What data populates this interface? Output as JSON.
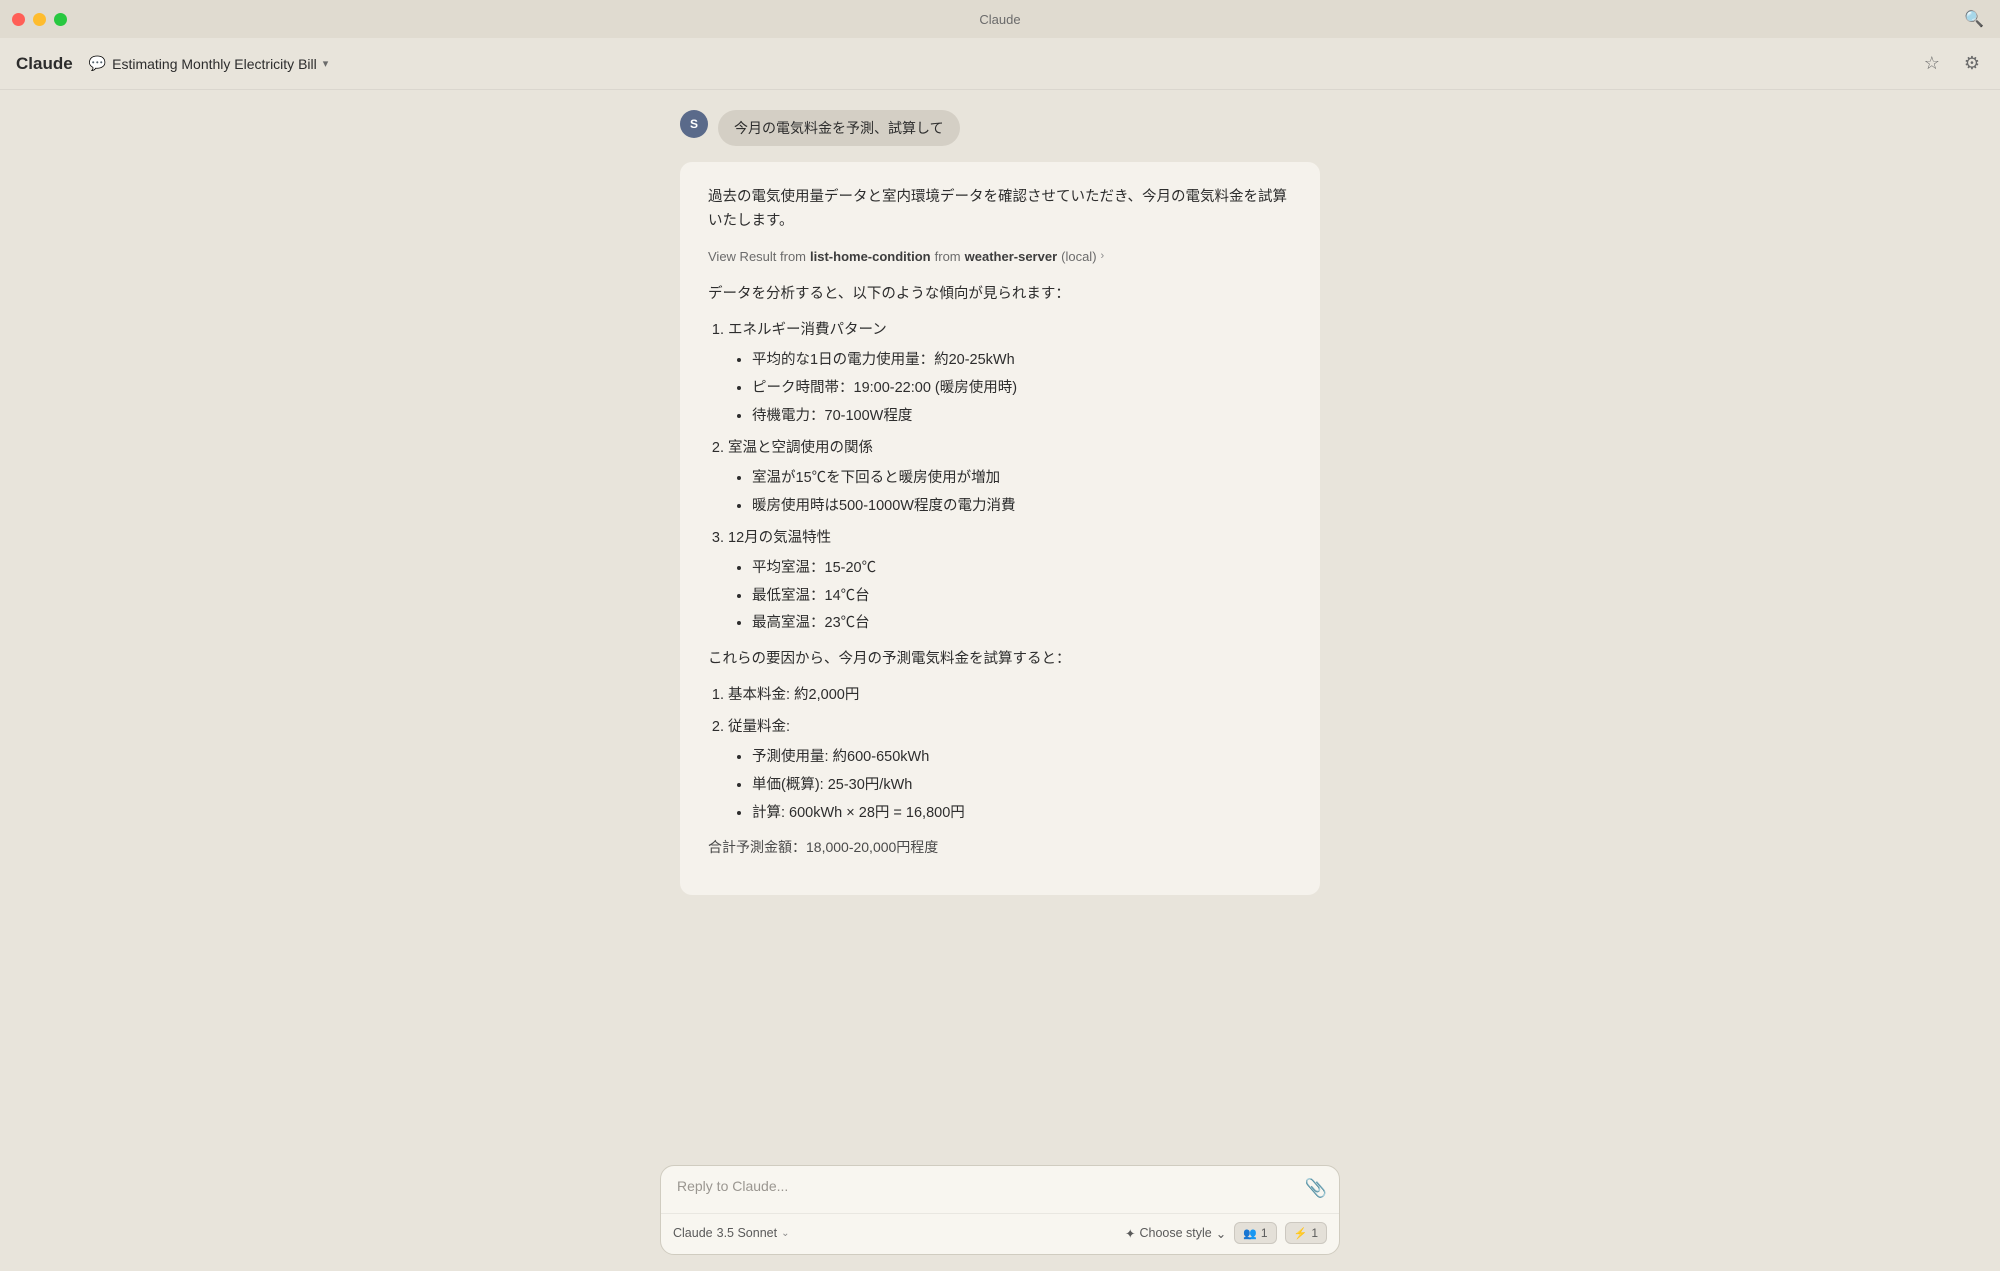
{
  "window": {
    "title": "Claude",
    "controls": {
      "close": "close",
      "minimize": "minimize",
      "maximize": "maximize"
    }
  },
  "navbar": {
    "brand": "Claude",
    "chat_title": "Estimating Monthly Electricity Bill",
    "chevron": "▾",
    "star_label": "★",
    "settings_label": "⚙"
  },
  "user_message": {
    "avatar_initial": "S",
    "text": "今月の電気料金を予測、試算して"
  },
  "claude_response": {
    "intro": "過去の電気使用量データと室内環境データを確認させていただき、今月の電気料金を試算いたします。",
    "view_result": {
      "prefix": "View Result from",
      "tool_name": "list-home-condition",
      "from_label": "from",
      "server_name": "weather-server",
      "server_type": "(local)",
      "chevron": "›"
    },
    "analysis_intro": "データを分析すると、以下のような傾向が見られます：",
    "sections": [
      {
        "number": "1.",
        "title": "エネルギー消費パターン",
        "bullets": [
          "平均的な1日の電力使用量：約20-25kWh",
          "ピーク時間帯：19:00-22:00 (暖房使用時)",
          "待機電力：70-100W程度"
        ]
      },
      {
        "number": "2.",
        "title": "室温と空調使用の関係",
        "bullets": [
          "室温が15℃を下回ると暖房使用が増加",
          "暖房使用時は500-1000W程度の電力消費"
        ]
      },
      {
        "number": "3.",
        "title": "12月の気温特性",
        "bullets": [
          "平均室温：15-20℃",
          "最低室温：14℃台",
          "最高室温：23℃台"
        ]
      }
    ],
    "calc_intro": "これらの要因から、今月の予測電気料金を試算すると：",
    "calc_sections": [
      {
        "number": "1.",
        "title": "基本料金: 約2,000円"
      },
      {
        "number": "2.",
        "title": "従量料金:",
        "bullets": [
          "予測使用量: 約600-650kWh",
          "単価(概算): 25-30円/kWh",
          "計算: 600kWh × 28円 = 16,800円"
        ]
      }
    ],
    "partial_text": "合計予測金額：18,000-20,000円程度"
  },
  "input": {
    "placeholder": "Reply to Claude...",
    "attach_icon": "📎",
    "model_label": "Claude",
    "model_version": "3.5 Sonnet",
    "model_chevron": "⌄",
    "style_icon": "✦",
    "style_label": "Choose style",
    "style_chevron": "⌄",
    "pill_1_icon": "👥",
    "pill_1_count": "1",
    "pill_2_icon": "⚡",
    "pill_2_count": "1"
  },
  "sidebar_toggle": "☰",
  "user_avatar_initial": "S"
}
